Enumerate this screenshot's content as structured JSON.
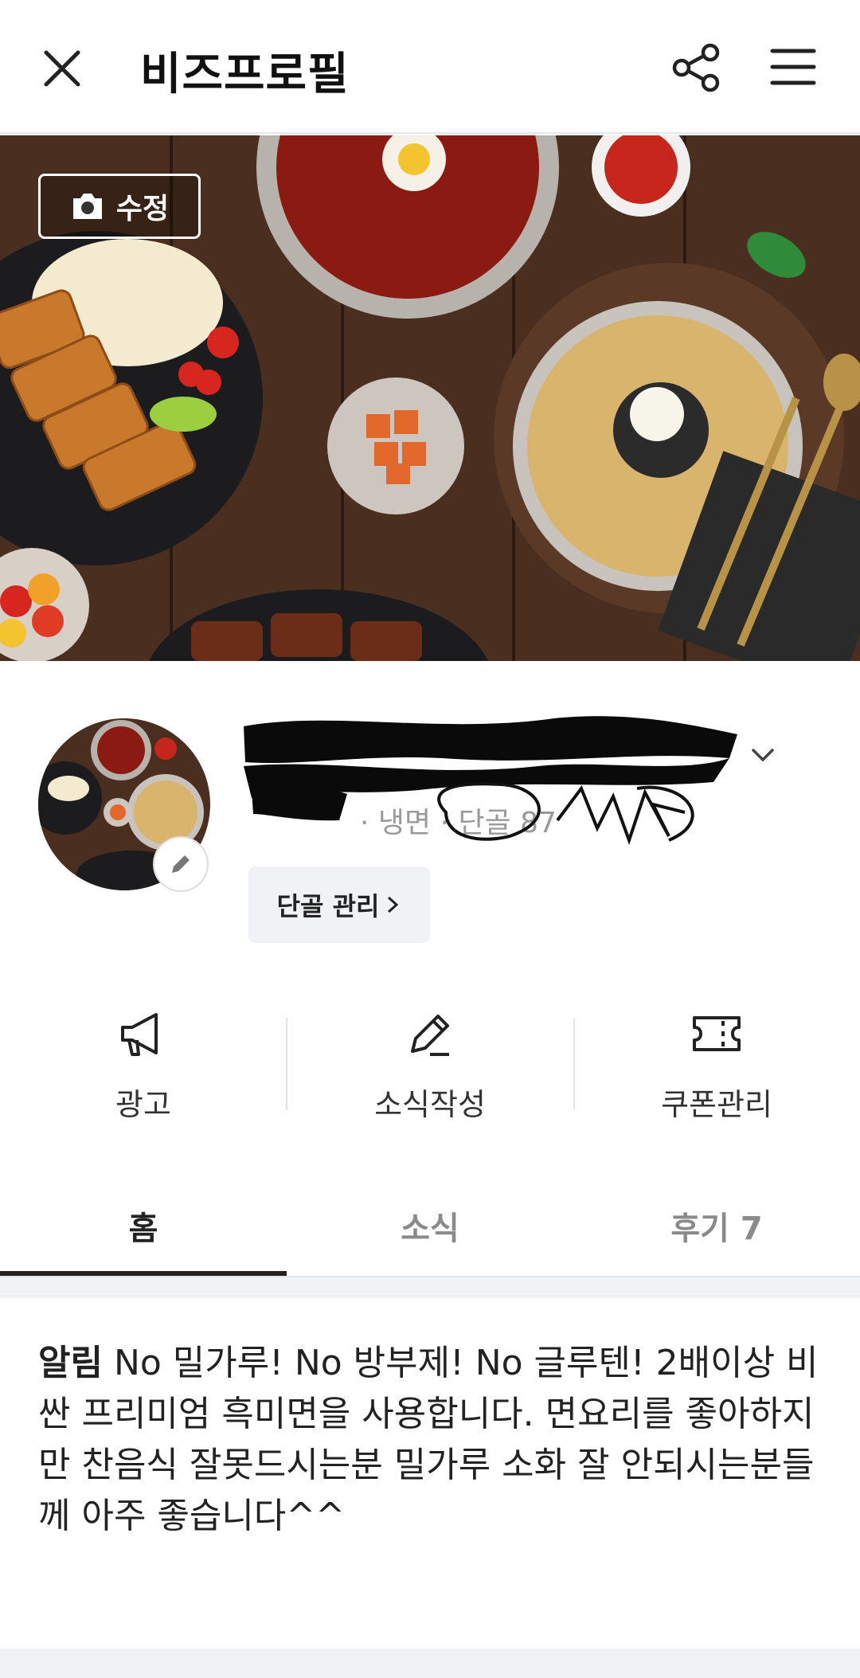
{
  "header": {
    "title": "비즈프로필"
  },
  "cover": {
    "edit_label": "수정"
  },
  "profile": {
    "meta_text": "· 냉면 · 단골 87",
    "regular_button_label": "단골 관리"
  },
  "actions": [
    {
      "label": "광고",
      "icon": "megaphone-icon"
    },
    {
      "label": "소식작성",
      "icon": "pencil-icon"
    },
    {
      "label": "쿠폰관리",
      "icon": "ticket-icon"
    }
  ],
  "tabs": [
    {
      "label": "홈",
      "active": true
    },
    {
      "label": "소식",
      "active": false
    },
    {
      "label": "후기 7",
      "active": false
    }
  ],
  "notice": {
    "tag": "알림",
    "text": "No 밀가루! No 방부제! No 글루텐! 2배이상 비싼 프리미엄 흑미면을 사용합니다. 면요리를 좋아하지만 찬음식 잘못드시는분 밀가루 소화 잘 안되시는분들께 아주 좋습니다^^"
  },
  "colors": {
    "accent_text": "#222222",
    "muted_text": "#8a8a8a",
    "divider": "#e6e6e6",
    "surface_gray": "#f1f2f5"
  }
}
